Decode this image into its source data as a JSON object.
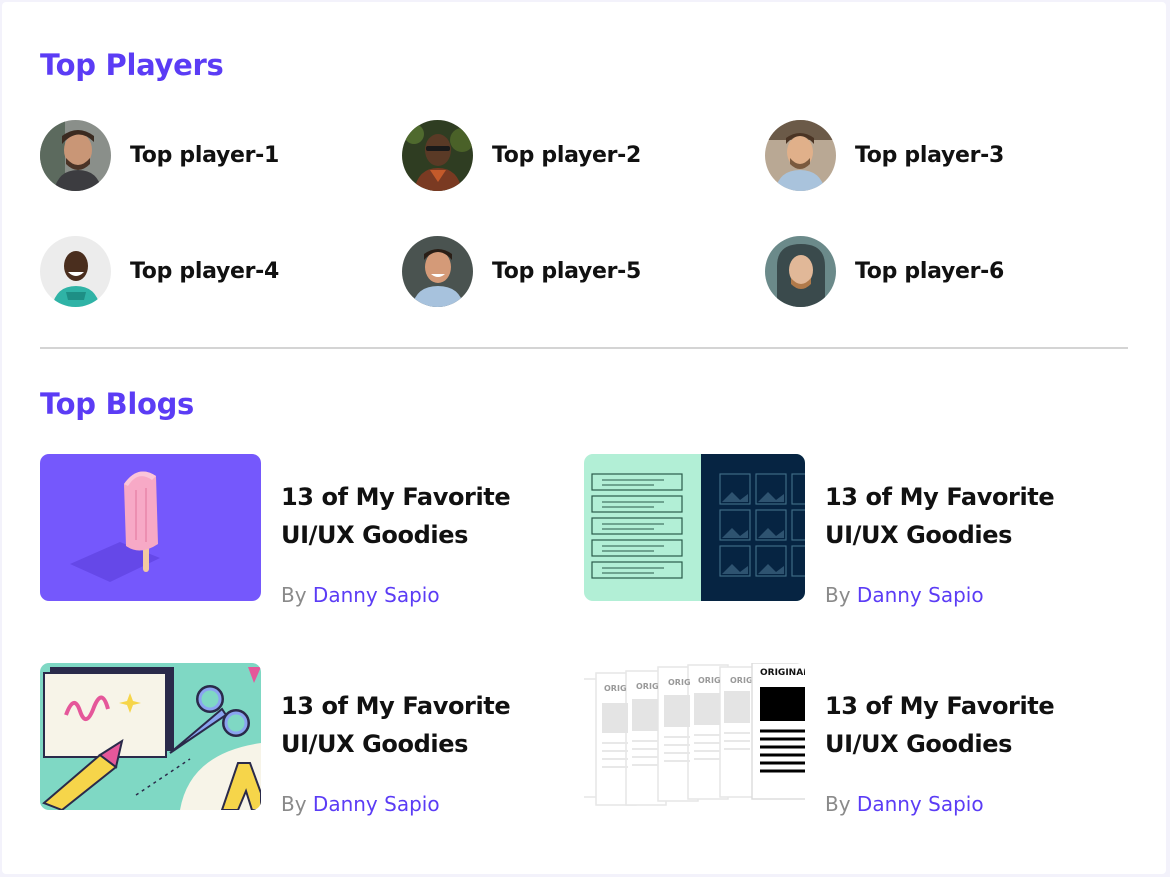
{
  "players_section": {
    "title": "Top Players",
    "players": [
      {
        "name": "Top player-1",
        "avatar": "avatar-icon"
      },
      {
        "name": "Top player-2",
        "avatar": "avatar-icon"
      },
      {
        "name": "Top player-3",
        "avatar": "avatar-icon"
      },
      {
        "name": "Top player-4",
        "avatar": "avatar-icon"
      },
      {
        "name": "Top player-5",
        "avatar": "avatar-icon"
      },
      {
        "name": "Top player-6",
        "avatar": "avatar-icon"
      }
    ]
  },
  "blogs_section": {
    "title": "Top Blogs",
    "blogs": [
      {
        "title": "13 of My Favorite UI/UX Goodies",
        "by": "By",
        "author": "Danny Sapio",
        "thumbnail": "popsicle-illustration"
      },
      {
        "title": "13 of My Favorite UI/UX Goodies",
        "by": "By",
        "author": "Danny Sapio",
        "thumbnail": "wireframe-illustration"
      },
      {
        "title": "13 of My Favorite UI/UX Goodies",
        "by": "By",
        "author": "Danny Sapio",
        "thumbnail": "scissors-crayon-illustration"
      },
      {
        "title": "13 of My Favorite UI/UX Goodies",
        "by": "By",
        "author": "Danny Sapio",
        "thumbnail": "documents-illustration"
      }
    ],
    "thumbnail_text": {
      "doc_label": "ORIGINAL",
      "doc_label_short": "ORIG"
    }
  },
  "colors": {
    "accent": "#5b3cf5",
    "text": "#111111",
    "muted": "#8a8a8a",
    "divider": "#d4d4d4"
  }
}
